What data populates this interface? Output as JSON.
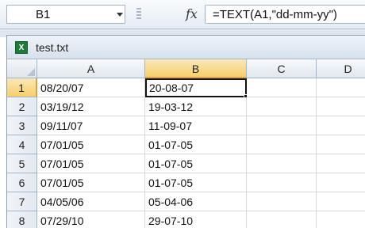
{
  "formula_bar": {
    "name_box": "B1",
    "fx_label": "fx",
    "formula": "=TEXT(A1,\"dd-mm-yy\")"
  },
  "workbook": {
    "title": "test.txt",
    "icon_letter": "X"
  },
  "grid": {
    "columns": [
      "A",
      "B",
      "C",
      "D"
    ],
    "selected_column": "B",
    "selected_row": "1",
    "rows": [
      {
        "row": "1",
        "a": "08/20/07",
        "b": "20-08-07"
      },
      {
        "row": "2",
        "a": "03/19/12",
        "b": "19-03-12"
      },
      {
        "row": "3",
        "a": "09/11/07",
        "b": "11-09-07"
      },
      {
        "row": "4",
        "a": "07/01/05",
        "b": "01-07-05"
      },
      {
        "row": "5",
        "a": "07/01/05",
        "b": "01-07-05"
      },
      {
        "row": "6",
        "a": "07/01/05",
        "b": "01-07-05"
      },
      {
        "row": "7",
        "a": "04/05/06",
        "b": "05-04-06"
      },
      {
        "row": "8",
        "a": "07/29/10",
        "b": "29-07-10"
      }
    ]
  },
  "colors": {
    "selection_header": "#f5cf6d",
    "excel_icon": "#1f7a3a"
  }
}
